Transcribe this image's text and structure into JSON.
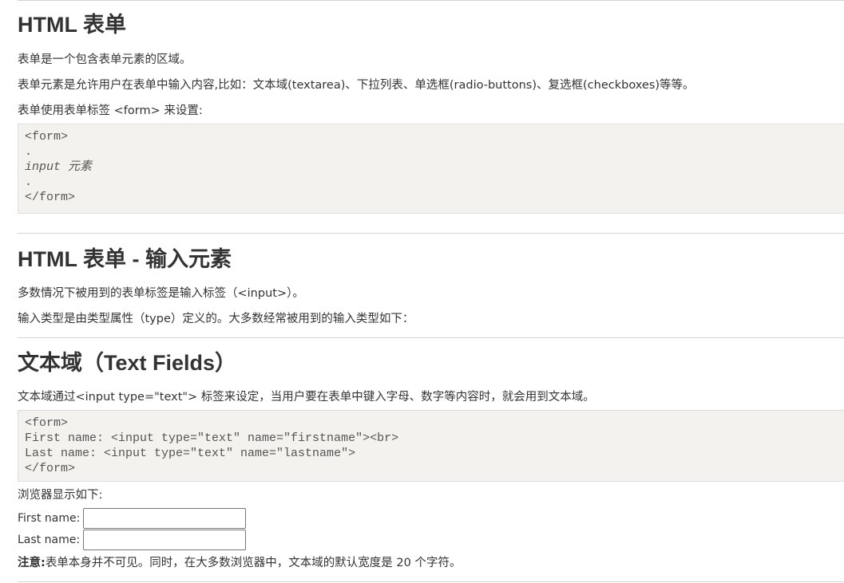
{
  "section1": {
    "title": "HTML 表单",
    "para1": "表单是一个包含表单元素的区域。",
    "para2": "表单元素是允许用户在表单中输入内容,比如：文本域(textarea)、下拉列表、单选框(radio-buttons)、复选框(checkboxes)等等。",
    "para3": "表单使用表单标签 <form> 来设置:",
    "code": {
      "line1": "<form>",
      "line2": ".",
      "line3": "input 元素",
      "line4": ".",
      "line5": "</form>"
    }
  },
  "section2": {
    "title": "HTML 表单 - 输入元素",
    "para1": "多数情况下被用到的表单标签是输入标签（<input>）。",
    "para2": "输入类型是由类型属性（type）定义的。大多数经常被用到的输入类型如下："
  },
  "section3": {
    "title": "文本域（Text Fields）",
    "para1": "文本域通过<input type=\"text\"> 标签来设定，当用户要在表单中键入字母、数字等内容时，就会用到文本域。",
    "code": {
      "line1": "<form>",
      "line2": "First name: <input type=\"text\" name=\"firstname\"><br>",
      "line3": "Last name: <input type=\"text\" name=\"lastname\">",
      "line4": "</form>"
    },
    "browser_label": "浏览器显示如下:",
    "form": {
      "first_label": "First name:",
      "first_value": "",
      "last_label": "Last name:",
      "last_value": ""
    },
    "note_label": "注意:",
    "note_text": "表单本身并不可见。同时，在大多数浏览器中，文本域的默认宽度是 20 个字符。"
  }
}
